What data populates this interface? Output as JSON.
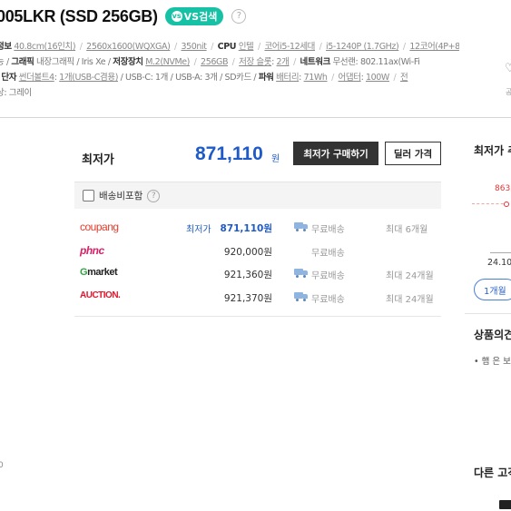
{
  "header": {
    "title": "005LKR (SSD 256GB)",
    "vs_button": "VS검색",
    "vs_icon": "vs",
    "help": "?",
    "spec_lines": [
      [
        {
          "t": "정보",
          "k": true
        },
        {
          "t": " "
        },
        {
          "t": "40.8cm(16인치)",
          "u": true
        },
        {
          "t": " / ",
          "s": true
        },
        {
          "t": "2560x1600(WQXGA)",
          "u": true
        },
        {
          "t": " / ",
          "s": true
        },
        {
          "t": "350nit",
          "u": true
        },
        {
          "t": " / ",
          "s": true
        },
        {
          "t": "CPU",
          "k": true
        },
        {
          "t": " "
        },
        {
          "t": "인텔",
          "u": true
        },
        {
          "t": " / ",
          "s": true
        },
        {
          "t": "코어i5-12세대",
          "u": true
        },
        {
          "t": " / ",
          "s": true
        },
        {
          "t": "i5-1240P (1.7GHz)",
          "u": true
        },
        {
          "t": " / ",
          "s": true
        },
        {
          "t": "12코어(4P+8",
          "u": true
        }
      ],
      [
        {
          "t": "능 / "
        },
        {
          "t": "그래픽",
          "k": true
        },
        {
          "t": " 내장그래픽 / Iris Xe / "
        },
        {
          "t": "저장장치",
          "k": true
        },
        {
          "t": " "
        },
        {
          "t": "M.2(NVMe)",
          "u": true
        },
        {
          "t": " / ",
          "s": true
        },
        {
          "t": "256GB",
          "u": true
        },
        {
          "t": " / ",
          "s": true
        },
        {
          "t": "저장 슬롯",
          "u": true
        },
        {
          "t": ": "
        },
        {
          "t": "2개",
          "u": true
        },
        {
          "t": " / ",
          "s": true
        },
        {
          "t": "네트워크",
          "k": true
        },
        {
          "t": " 무선랜: 802.11ax(Wi-Fi"
        }
      ],
      [
        {
          "t": "/ "
        },
        {
          "t": "단자",
          "k": true
        },
        {
          "t": " "
        },
        {
          "t": "썬더볼트4",
          "u": true
        },
        {
          "t": ": "
        },
        {
          "t": "1개(USB-C겸용)",
          "u": true
        },
        {
          "t": " / USB-C: 1개 / USB-A: 3개 / SD카드 / "
        },
        {
          "t": "파워",
          "k": true
        },
        {
          "t": " "
        },
        {
          "t": "배터리",
          "u": true
        },
        {
          "t": ": "
        },
        {
          "t": "71Wh",
          "u": true
        },
        {
          "t": " / ",
          "s": true
        },
        {
          "t": "어댑터",
          "u": true
        },
        {
          "t": ": "
        },
        {
          "t": "100W",
          "u": true
        },
        {
          "t": " / ",
          "s": true
        },
        {
          "t": "전",
          "u": true
        }
      ],
      [
        {
          "t": "상: 그레이"
        }
      ]
    ],
    "heart_icon": "heart-icon",
    "right_label": "공"
  },
  "price_box": {
    "lowest_label": "최저가",
    "lowest_price": "871,110",
    "lowest_unit": "원",
    "buy_button": "최저가 구매하기",
    "dealer_button": "딜러 가격",
    "filter_label": "배송비포함",
    "filter_help": "?",
    "offers": [
      {
        "mall": "coupang",
        "mall_label": "coupang",
        "lowest_tag": "최저가",
        "price": "871,110원",
        "best": true,
        "truck": true,
        "ship": "무료배송",
        "install": "최대 6개월"
      },
      {
        "mall": "phone",
        "mall_label": "phnc",
        "price": "920,000원",
        "best": false,
        "truck": false,
        "ship": "무료배송",
        "install": ""
      },
      {
        "mall": "gmarket",
        "mall_label": "market",
        "price": "921,360원",
        "best": false,
        "truck": true,
        "ship": "무료배송",
        "install": "최대 24개월"
      },
      {
        "mall": "auction",
        "mall_label": "AUCTION.",
        "price": "921,370원",
        "best": false,
        "truck": true,
        "ship": "무료배송",
        "install": "최대 24개월"
      }
    ]
  },
  "side": {
    "title": "최저가 추",
    "chart_price": "863,",
    "chart_date": "24.10",
    "period_button": "1개월",
    "review_title": "상품의견",
    "review_item": "• 햄 은 보",
    "others_title": "다른 고객"
  },
  "colors": {
    "accent": "#1e5bc6",
    "vs": "#17c1a5",
    "buy": "#333333",
    "chart_red": "#e23636"
  },
  "left_mini": "0"
}
